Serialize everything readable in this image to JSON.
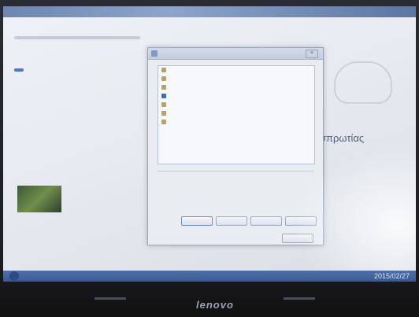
{
  "dialog": {
    "title": "",
    "list_items": [
      {
        "label": "",
        "selected": false
      },
      {
        "label": "",
        "selected": false
      },
      {
        "label": "",
        "selected": false
      },
      {
        "label": "",
        "selected": true
      },
      {
        "label": "",
        "selected": false
      },
      {
        "label": "",
        "selected": false
      },
      {
        "label": "",
        "selected": false
      }
    ],
    "description_label": "",
    "description_text": "",
    "buttons": [
      "",
      "",
      "",
      ""
    ],
    "ok_button": ""
  },
  "background_page": {
    "button_label": "",
    "right_heading": "σπρωτίας"
  },
  "taskbar": {
    "clock": "2015/02/27"
  },
  "monitor": {
    "brand": "lenovo"
  },
  "colors": {
    "taskbar": "#3a5a94",
    "dialog_bg": "#e9ecf1",
    "selection": "#3f6bbf"
  }
}
